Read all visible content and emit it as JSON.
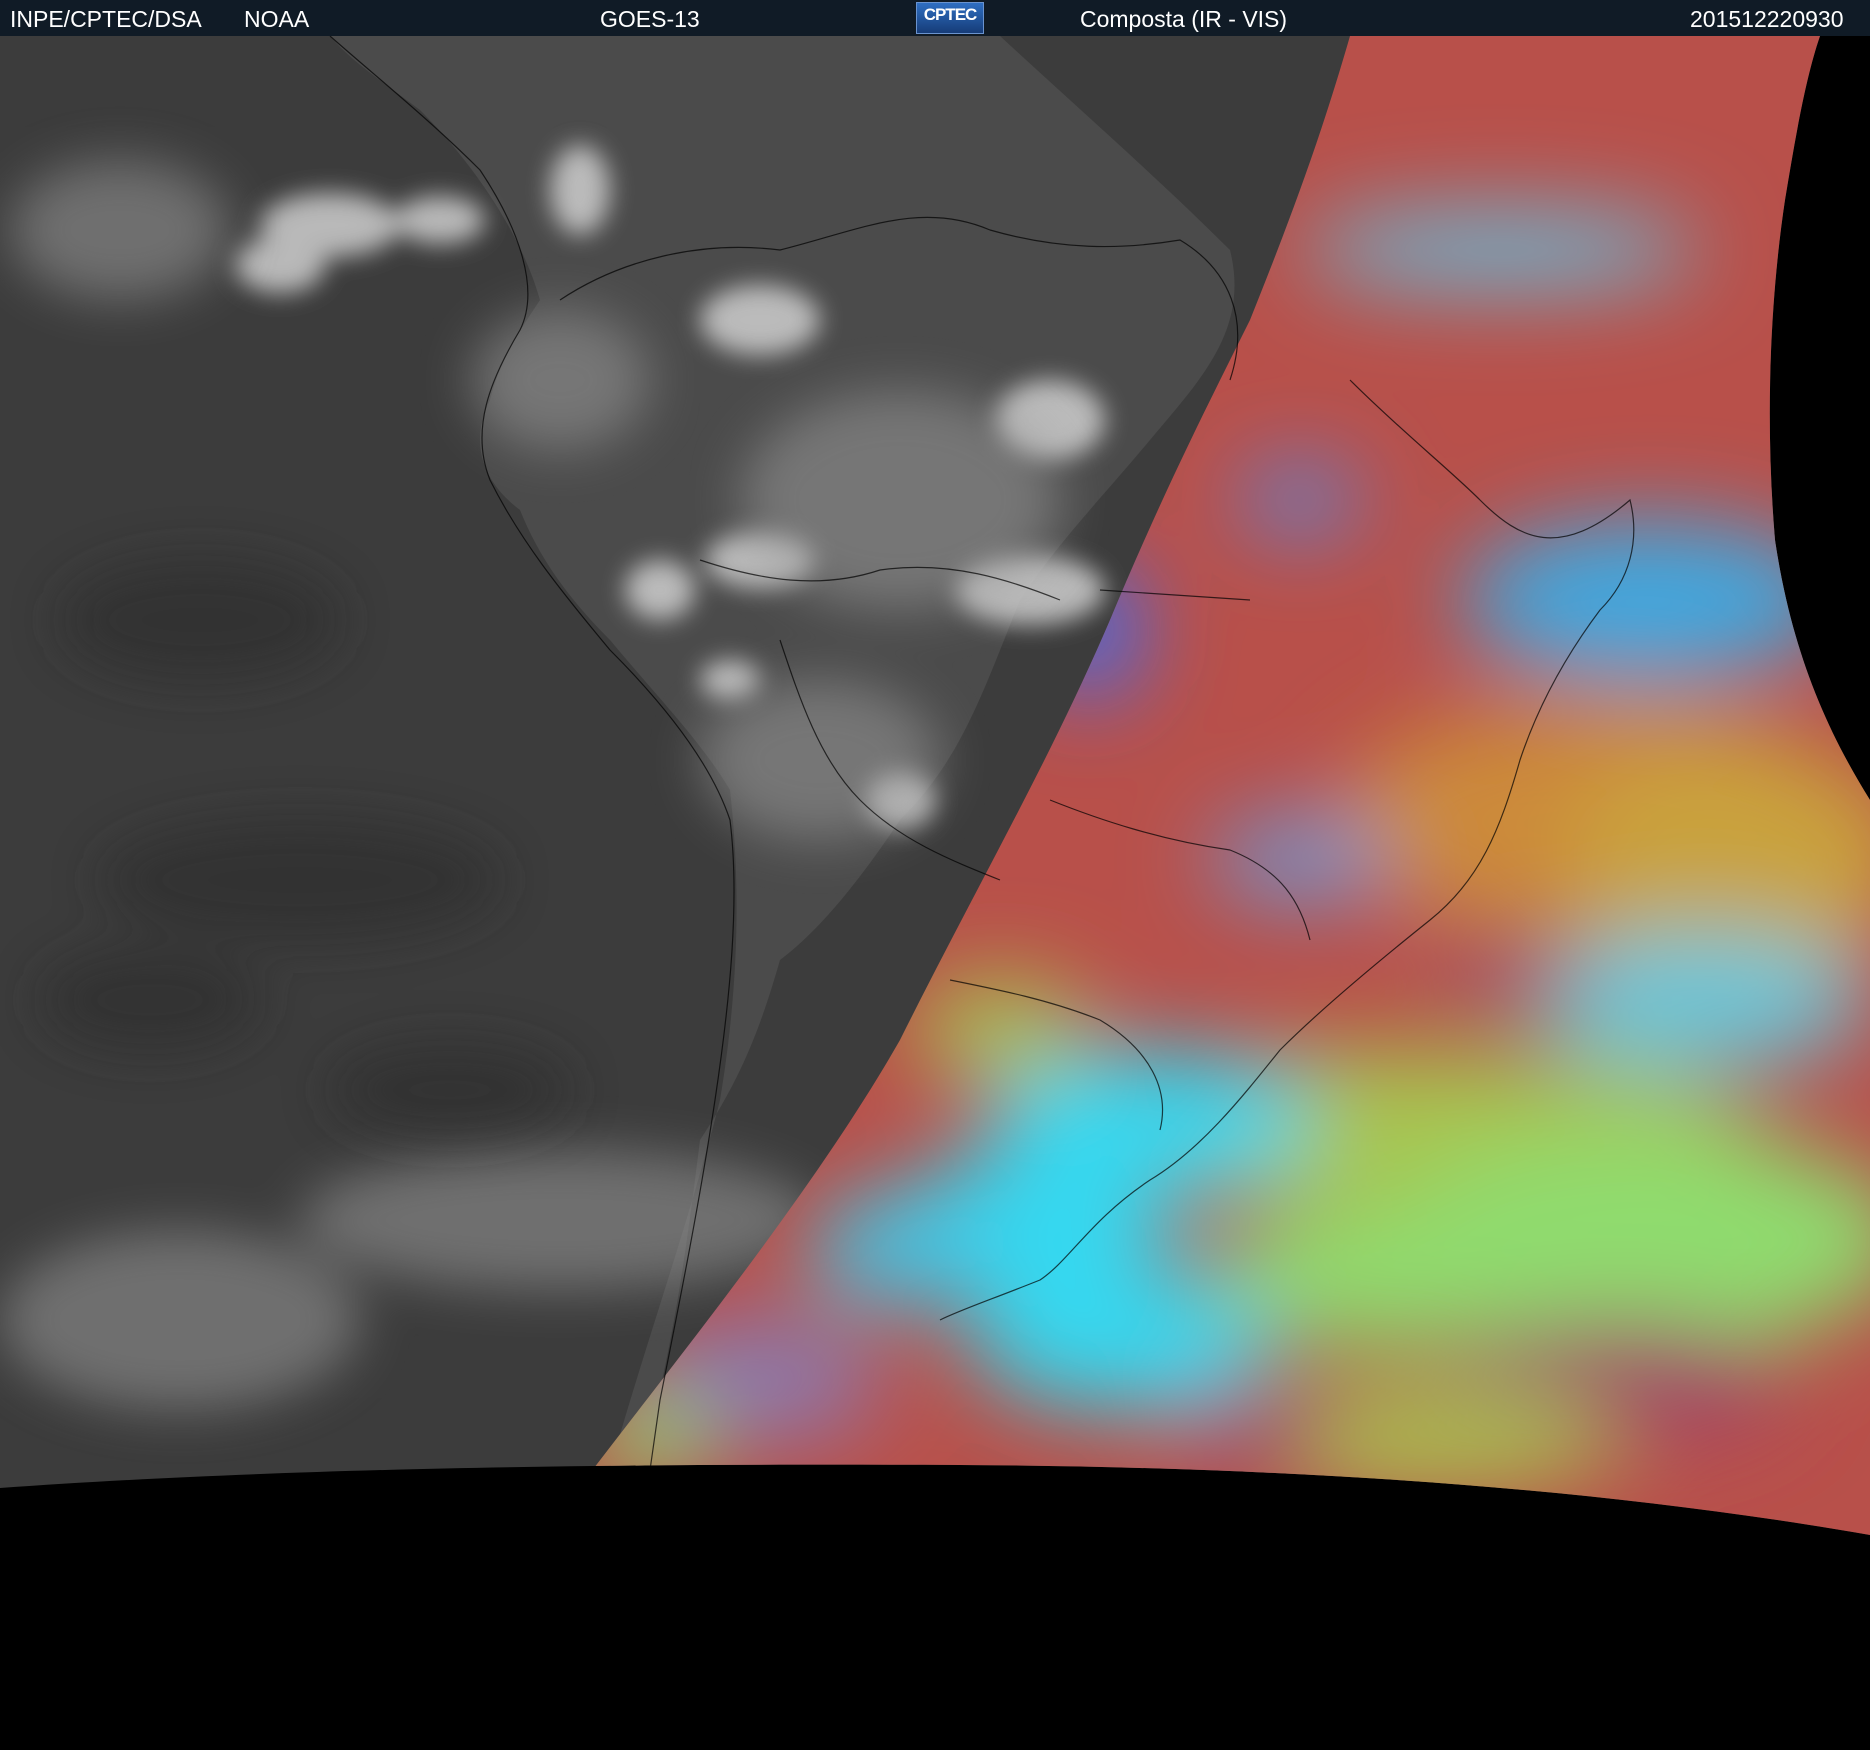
{
  "header": {
    "institution": "INPE/CPTEC/DSA",
    "agency": "NOAA",
    "satellite": "GOES-13",
    "logo_text": "CPTEC",
    "product": "Composta (IR - VIS)",
    "timestamp": "201512220930"
  },
  "colors": {
    "header_bg": "#101b26",
    "ir_ocean": "#3b3b3b",
    "ir_land": "#4a4a4a",
    "ir_cloud": "#d0d0d0",
    "vis_red": "#b8504a",
    "vis_orange": "#cc7f3c",
    "vis_yellow_green": "#a8c450",
    "vis_green": "#8fdb6e",
    "vis_cyan": "#35d8f0",
    "vis_blue": "#3a6cf0",
    "vis_magenta": "#a04a6a",
    "background": "#000000"
  }
}
